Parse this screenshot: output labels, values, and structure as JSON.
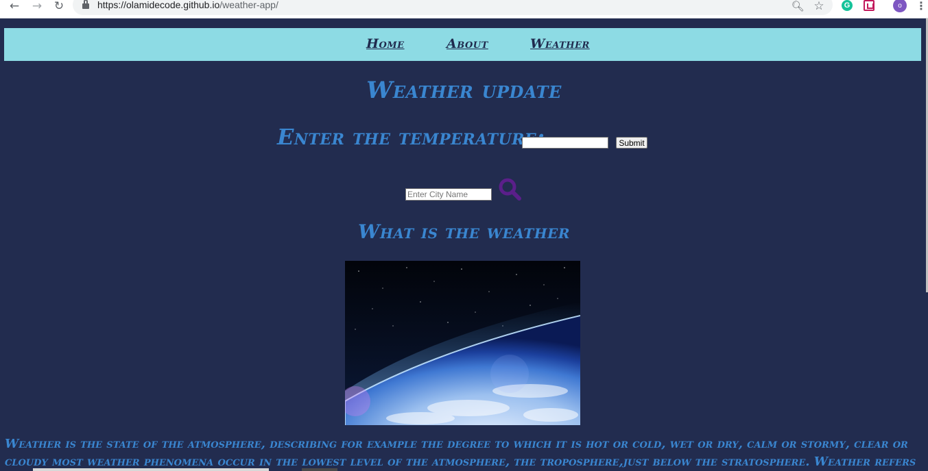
{
  "browser": {
    "url_host": "https://olamidecode.github.io",
    "url_path": "/weather-app/",
    "avatar_letter": "o",
    "grammarly_letter": "G"
  },
  "nav": {
    "home": "Home",
    "about": "About",
    "weather": "Weather"
  },
  "main": {
    "title": "Weather update",
    "temp_label": "Enter the temperature:",
    "temp_value": "",
    "submit_label": "Submit",
    "city_placeholder": "Enter City Name",
    "subtitle": "What is the weather",
    "paragraph": "Weather is the state of the atmosphere, describing for example the degree to which it is hot or cold, wet or dry, calm or stormy, clear or cloudy most weather phenomena occur in the lowest level of the atmosphere, the troposphere,just below the stratosphere. Weather refers to day-to-day"
  },
  "colors": {
    "page_bg": "#222c4f",
    "nav_bg": "#8ddbe4",
    "heading": "#3a86d0",
    "search_icon": "#5b1f8a"
  }
}
